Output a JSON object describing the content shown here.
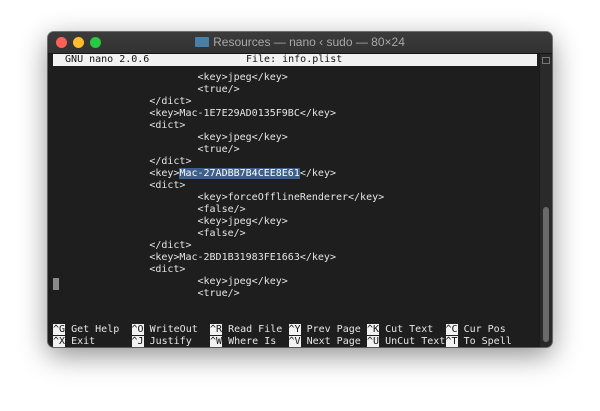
{
  "window": {
    "title": "Resources — nano ‹ sudo — 80×24",
    "icon": "folder-icon"
  },
  "colors": {
    "close": "#fe5f57",
    "minimize": "#febc2e",
    "zoom": "#28c840",
    "selection": "#3d5f8a"
  },
  "nano": {
    "version": "  GNU nano 2.0.6",
    "file": "File: info.plist",
    "lines": [
      "\t\t\t<key>jpeg</key>",
      "\t\t\t<true/>",
      "\t\t</dict>",
      "\t\t<key>Mac-1E7E29AD0135F9BC</key>",
      "\t\t<dict>",
      "\t\t\t<key>jpeg</key>",
      "\t\t\t<true/>",
      "\t\t</dict>",
      "\t\t<key>",
      "\t\t<dict>",
      "\t\t\t<key>forceOfflineRenderer</key>",
      "\t\t\t<false/>",
      "\t\t\t<key>jpeg</key>",
      "\t\t\t<false/>",
      "\t\t</dict>",
      "\t\t<key>Mac-2BD1B31983FE1663</key>",
      "\t\t<dict>",
      "\t\t\t<key>jpeg</key>",
      "\t\t\t<true/>"
    ],
    "selected_text": "Mac-27ADBB7B4CEE8E61",
    "selected_suffix": "</key>",
    "shortcuts": [
      {
        "key": "^G",
        "label": "Get Help"
      },
      {
        "key": "^O",
        "label": "WriteOut"
      },
      {
        "key": "^R",
        "label": "Read File"
      },
      {
        "key": "^Y",
        "label": "Prev Page"
      },
      {
        "key": "^K",
        "label": "Cut Text"
      },
      {
        "key": "^C",
        "label": "Cur Pos"
      },
      {
        "key": "^X",
        "label": "Exit"
      },
      {
        "key": "^J",
        "label": "Justify"
      },
      {
        "key": "^W",
        "label": "Where Is"
      },
      {
        "key": "^V",
        "label": "Next Page"
      },
      {
        "key": "^U",
        "label": "UnCut Text"
      },
      {
        "key": "^T",
        "label": "To Spell"
      }
    ]
  }
}
